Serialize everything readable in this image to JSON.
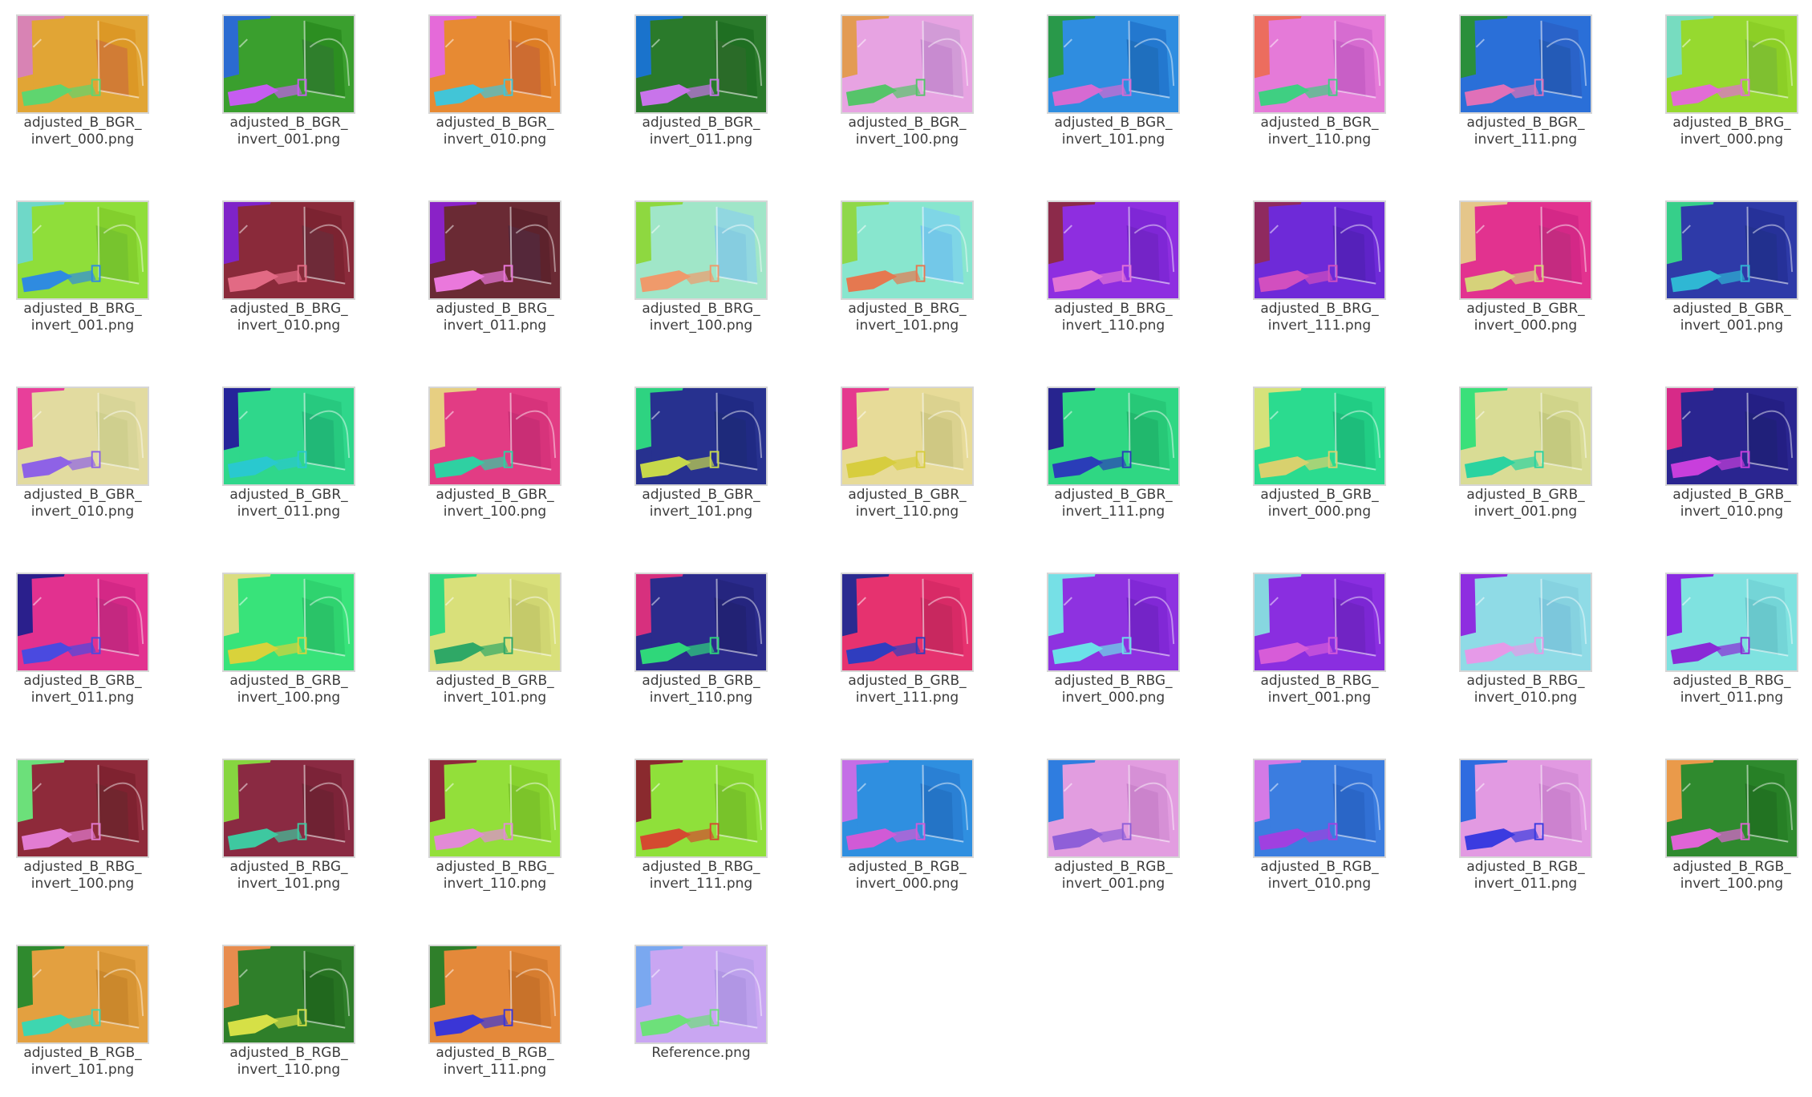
{
  "window": {
    "view": "icon-grid"
  },
  "files": [
    {
      "name": "adjusted_B_BGR_\ninvert_000.png",
      "colors": [
        "#d883b4",
        "#e1a535",
        "#dc9826",
        "#d17c35",
        "#5fd56f"
      ]
    },
    {
      "name": "adjusted_B_BGR_\ninvert_001.png",
      "colors": [
        "#2b6bd1",
        "#3a9f2e",
        "#2c8e21",
        "#2f7f2c",
        "#c65cf0"
      ]
    },
    {
      "name": "adjusted_B_BGR_\ninvert_010.png",
      "colors": [
        "#e56ad9",
        "#e78a33",
        "#dd7d24",
        "#cd6c31",
        "#42c5d7"
      ]
    },
    {
      "name": "adjusted_B_BGR_\ninvert_011.png",
      "colors": [
        "#1a73cc",
        "#2a7a2b",
        "#1f6f22",
        "#2a6b28",
        "#c874ea"
      ]
    },
    {
      "name": "adjusted_B_BGR_\ninvert_100.png",
      "colors": [
        "#e39b53",
        "#e7a3e2",
        "#d29bd7",
        "#c88bd0",
        "#56c46a"
      ]
    },
    {
      "name": "adjusted_B_BGR_\ninvert_101.png",
      "colors": [
        "#29994a",
        "#2f8de0",
        "#2378cf",
        "#1f6fbe",
        "#d66ad2"
      ]
    },
    {
      "name": "adjusted_B_BGR_\ninvert_110.png",
      "colors": [
        "#ec6d5e",
        "#e57ad8",
        "#d66cd0",
        "#c85fc6",
        "#3fcf82"
      ]
    },
    {
      "name": "adjusted_B_BGR_\ninvert_111.png",
      "colors": [
        "#2a8f3b",
        "#2a6fd8",
        "#2a63c9",
        "#245bb7",
        "#e070b8"
      ]
    },
    {
      "name": "adjusted_B_BRG_\ninvert_000.png",
      "colors": [
        "#77dcc0",
        "#96d92f",
        "#8ccf26",
        "#7fc030",
        "#e26cd5"
      ]
    },
    {
      "name": "adjusted_B_BRG_\ninvert_001.png",
      "colors": [
        "#6fd8c8",
        "#8fde3a",
        "#83cf2d",
        "#77c42e",
        "#2f8be0"
      ]
    },
    {
      "name": "adjusted_B_BRG_\ninvert_010.png",
      "colors": [
        "#7f23c8",
        "#8a2a3a",
        "#7c2331",
        "#6e2a38",
        "#e26a84"
      ]
    },
    {
      "name": "adjusted_B_BRG_\ninvert_011.png",
      "colors": [
        "#8a22c7",
        "#6a2a34",
        "#5d222c",
        "#55283a",
        "#ea78dc"
      ]
    },
    {
      "name": "adjusted_B_BRG_\ninvert_100.png",
      "colors": [
        "#8ed840",
        "#a0e6c8",
        "#91d7e0",
        "#86cde0",
        "#ef9a6b"
      ]
    },
    {
      "name": "adjusted_B_BRG_\ninvert_101.png",
      "colors": [
        "#8fd84a",
        "#88e6ce",
        "#7fd6e6",
        "#73c8e8",
        "#e57850"
      ]
    },
    {
      "name": "adjusted_B_BRG_\ninvert_110.png",
      "colors": [
        "#8c2a4a",
        "#8e2ee0",
        "#7f27d6",
        "#7424c7",
        "#e273d6"
      ]
    },
    {
      "name": "adjusted_B_BRG_\ninvert_111.png",
      "colors": [
        "#8f2a5f",
        "#6e2ad8",
        "#5f23c8",
        "#5521ba",
        "#d24fbf"
      ]
    },
    {
      "name": "adjusted_B_GBR_\ninvert_000.png",
      "colors": [
        "#e5c68a",
        "#e2328f",
        "#d42887",
        "#c42b80",
        "#d6d27a"
      ]
    },
    {
      "name": "adjusted_B_GBR_\ninvert_001.png",
      "colors": [
        "#36cf8a",
        "#2e3aa8",
        "#263199",
        "#22308e",
        "#2fb7d4"
      ]
    },
    {
      "name": "adjusted_B_GBR_\ninvert_010.png",
      "colors": [
        "#e83f9a",
        "#e2dba0",
        "#d8d598",
        "#cfcf8e",
        "#8e62e6"
      ]
    },
    {
      "name": "adjusted_B_GBR_\ninvert_011.png",
      "colors": [
        "#25249a",
        "#2fd78b",
        "#27c97f",
        "#21b877",
        "#29c9cf"
      ]
    },
    {
      "name": "adjusted_B_GBR_\ninvert_100.png",
      "colors": [
        "#e7cf82",
        "#e23c84",
        "#d7337b",
        "#c92e75",
        "#2fd0a2"
      ]
    },
    {
      "name": "adjusted_B_GBR_\ninvert_101.png",
      "colors": [
        "#2ed381",
        "#27318f",
        "#202a84",
        "#1e2a7b",
        "#c7d84a"
      ]
    },
    {
      "name": "adjusted_B_GBR_\ninvert_110.png",
      "colors": [
        "#e5398e",
        "#e7db98",
        "#dbd28f",
        "#cfc883",
        "#d7cd3e"
      ]
    },
    {
      "name": "adjusted_B_GBR_\ninvert_111.png",
      "colors": [
        "#27248f",
        "#2fd783",
        "#27c877",
        "#21b86d",
        "#2a3db8"
      ]
    },
    {
      "name": "adjusted_B_GRB_\ninvert_000.png",
      "colors": [
        "#d6e27a",
        "#2bdb8f",
        "#21cd84",
        "#1dbd7b",
        "#d8d16e"
      ]
    },
    {
      "name": "adjusted_B_GRB_\ninvert_001.png",
      "colors": [
        "#3ae07a",
        "#d9dc95",
        "#d0d48a",
        "#c4c97f",
        "#2bd3a0"
      ]
    },
    {
      "name": "adjusted_B_GRB_\ninvert_010.png",
      "colors": [
        "#d72a88",
        "#2a2590",
        "#241f84",
        "#20207a",
        "#c83fdc"
      ]
    },
    {
      "name": "adjusted_B_GRB_\ninvert_011.png",
      "colors": [
        "#2a1f8c",
        "#e2318f",
        "#d42886",
        "#c42880",
        "#4a4ae0"
      ]
    },
    {
      "name": "adjusted_B_GRB_\ninvert_100.png",
      "colors": [
        "#dadd80",
        "#38e37a",
        "#2fd36f",
        "#2ac368",
        "#d9d23b"
      ]
    },
    {
      "name": "adjusted_B_GRB_\ninvert_101.png",
      "colors": [
        "#33d97f",
        "#d9e07a",
        "#d0d672",
        "#c5ca6a",
        "#2fa866"
      ]
    },
    {
      "name": "adjusted_B_GRB_\ninvert_110.png",
      "colors": [
        "#d7307e",
        "#2b2b8c",
        "#25257f",
        "#222274",
        "#2fd77a"
      ]
    },
    {
      "name": "adjusted_B_GRB_\ninvert_111.png",
      "colors": [
        "#2a2a90",
        "#e6326f",
        "#d82a66",
        "#c8285f",
        "#2f3dbf"
      ]
    },
    {
      "name": "adjusted_B_RBG_\ninvert_000.png",
      "colors": [
        "#76e0e6",
        "#8e32e0",
        "#8128d6",
        "#7424c7",
        "#6be0e8"
      ]
    },
    {
      "name": "adjusted_B_RBG_\ninvert_001.png",
      "colors": [
        "#87d7e0",
        "#8a2ee0",
        "#7c27d4",
        "#7124c4",
        "#d75cd8"
      ]
    },
    {
      "name": "adjusted_B_RBG_\ninvert_010.png",
      "colors": [
        "#8e2ee0",
        "#8fdbe6",
        "#86d2e0",
        "#7cc7dc",
        "#e69ae8"
      ]
    },
    {
      "name": "adjusted_B_RBG_\ninvert_011.png",
      "colors": [
        "#8a2ae2",
        "#7fe2e0",
        "#74d5d7",
        "#69c8cc",
        "#8a2ad6"
      ]
    },
    {
      "name": "adjusted_B_RBG_\ninvert_100.png",
      "colors": [
        "#6ce07a",
        "#8e2a3a",
        "#7f2230",
        "#71252e",
        "#e27cd2"
      ]
    },
    {
      "name": "adjusted_B_RBG_\ninvert_101.png",
      "colors": [
        "#86d640",
        "#8a2a42",
        "#7c2338",
        "#6f2233",
        "#3ec8a0"
      ]
    },
    {
      "name": "adjusted_B_RBG_\ninvert_110.png",
      "colors": [
        "#8e2a3a",
        "#93df3a",
        "#87d22e",
        "#7cc42a",
        "#e28ad6"
      ]
    },
    {
      "name": "adjusted_B_RBG_\ninvert_111.png",
      "colors": [
        "#8a2a2e",
        "#8fe03a",
        "#83d22e",
        "#78c32a",
        "#d44a30"
      ]
    },
    {
      "name": "adjusted_B_RGB_\ninvert_000.png",
      "colors": [
        "#c46ee6",
        "#2f8fe0",
        "#2a80d4",
        "#2474c6",
        "#d15ad6"
      ]
    },
    {
      "name": "adjusted_B_RGB_\ninvert_001.png",
      "colors": [
        "#2f7de0",
        "#e29de0",
        "#d690d6",
        "#cb83cc",
        "#8f5fd8"
      ]
    },
    {
      "name": "adjusted_B_RGB_\ninvert_010.png",
      "colors": [
        "#d47ae6",
        "#3b7de0",
        "#3170d4",
        "#2a66c7",
        "#a040e0"
      ]
    },
    {
      "name": "adjusted_B_RGB_\ninvert_011.png",
      "colors": [
        "#2f6ce0",
        "#e29ae2",
        "#d68ed8",
        "#cc82cf",
        "#3b3be0"
      ]
    },
    {
      "name": "adjusted_B_RGB_\ninvert_100.png",
      "colors": [
        "#ea9a4a",
        "#2f8a2e",
        "#278026",
        "#227322",
        "#e064d6"
      ]
    },
    {
      "name": "adjusted_B_RGB_\ninvert_101.png",
      "colors": [
        "#2f8a2e",
        "#e3a040",
        "#d79434",
        "#cb882c",
        "#3ed6b0"
      ]
    },
    {
      "name": "adjusted_B_RGB_\ninvert_110.png",
      "colors": [
        "#e88c4e",
        "#2f7f2a",
        "#277322",
        "#21681e",
        "#d6e046"
      ]
    },
    {
      "name": "adjusted_B_RGB_\ninvert_111.png",
      "colors": [
        "#2f7f2a",
        "#e4893a",
        "#d67d30",
        "#c8722a",
        "#3a36d6"
      ]
    },
    {
      "name": "Reference.png",
      "colors": [
        "#7aa8f0",
        "#c9a6f2",
        "#bca0ec",
        "#b196e4",
        "#6de07a"
      ]
    }
  ]
}
